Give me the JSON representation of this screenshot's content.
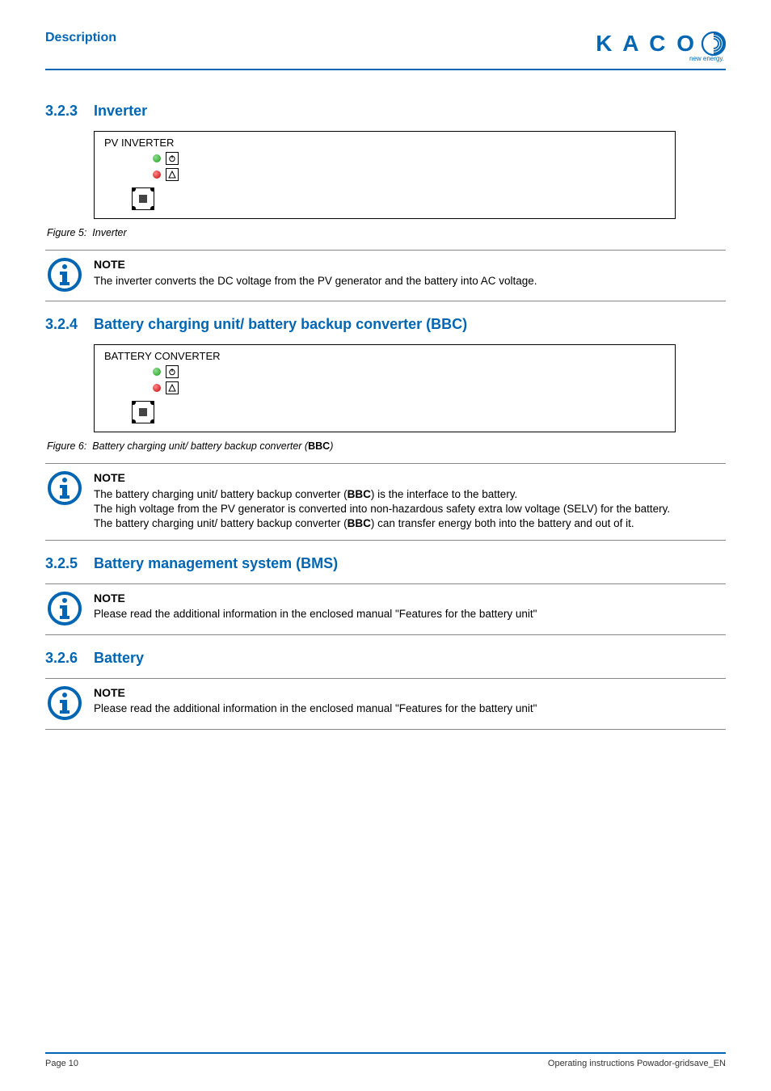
{
  "header": {
    "section": "Description"
  },
  "logo": {
    "text": "K A C O",
    "tag": "new energy."
  },
  "s1": {
    "num": "3.2.3",
    "title": "Inverter",
    "device_label": "PV INVERTER",
    "fig_prefix": "Figure 5:",
    "fig_text": "Inverter",
    "note_title": "NOTE",
    "note_body": "The inverter converts the DC voltage from the PV generator and the battery into AC voltage."
  },
  "s2": {
    "num": "3.2.4",
    "title": "Battery charging unit/ battery backup converter (BBC)",
    "device_label": "BATTERY CONVERTER",
    "fig_prefix": "Figure 6:",
    "fig_text_a": "Battery charging unit/ battery backup converter (",
    "fig_text_b": "BBC",
    "fig_text_c": ")",
    "note_title": "NOTE",
    "note_line1a": "The battery charging unit/ battery backup converter (",
    "note_line1b": "BBC",
    "note_line1c": ") is the interface to the battery.",
    "note_line2": "The high voltage from the PV generator is converted into non-hazardous safety extra low voltage (SELV) for the battery.",
    "note_line3a": "The battery charging unit/ battery backup converter (",
    "note_line3b": "BBC",
    "note_line3c": ") can transfer energy both into the battery and out of it."
  },
  "s3": {
    "num": "3.2.5",
    "title": "Battery management system (BMS)",
    "note_title": "NOTE",
    "note_body": "Please read the additional information in the enclosed manual \"Features for the battery unit\""
  },
  "s4": {
    "num": "3.2.6",
    "title": "Battery",
    "note_title": "NOTE",
    "note_body": "Please read the additional information in the enclosed manual \"Features for the battery unit\""
  },
  "footer": {
    "page": "Page 10",
    "doc": "Operating instructions Powador-gridsave_EN"
  }
}
